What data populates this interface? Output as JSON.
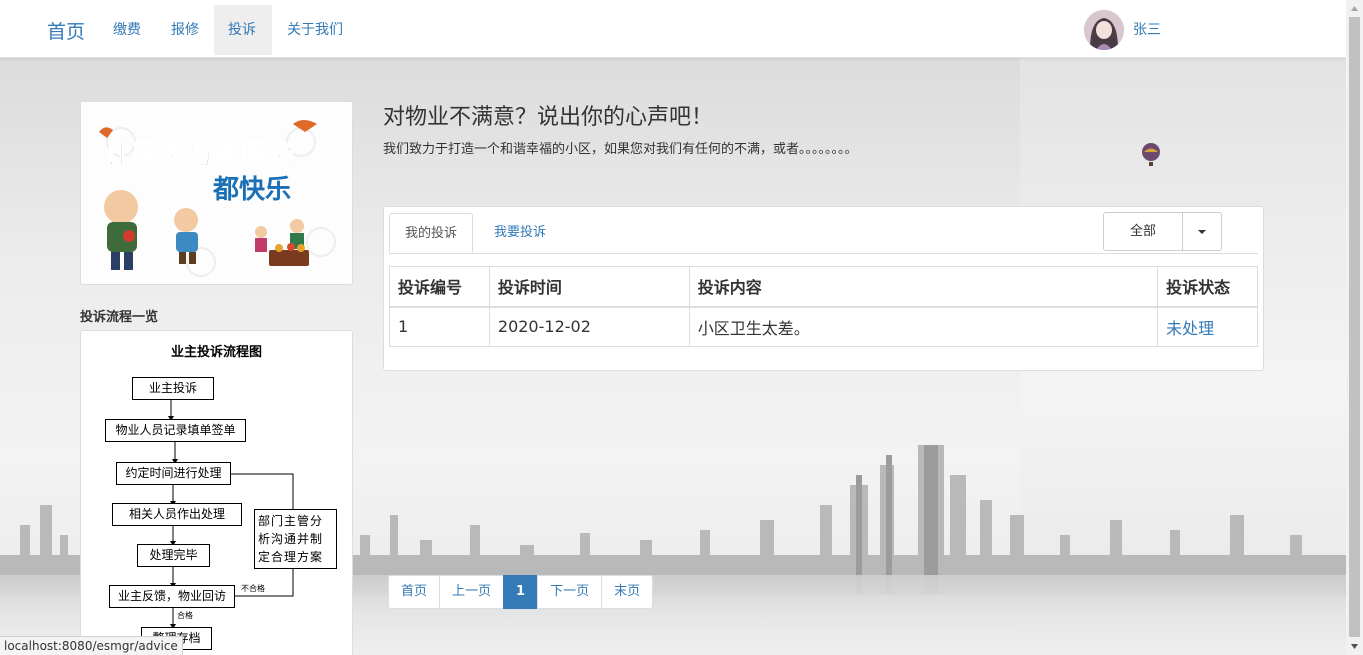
{
  "navbar": {
    "brand": "首页",
    "items": [
      "缴费",
      "报修",
      "投诉",
      "关于我们"
    ],
    "active_index": 2,
    "user_name": "张三"
  },
  "sidebar": {
    "banner_text_line1": "让服务与被服务",
    "banner_text_line2": "都快乐",
    "flow_title": "投诉流程一览",
    "flowchart": {
      "heading": "业主投诉流程图",
      "nodes": [
        "业主投诉",
        "物业人员记录填单签单",
        "约定时间进行处理",
        "相关人员作出处理",
        "处理完毕",
        "业主反馈，物业回访",
        "整理存档"
      ],
      "side_node": "部门主管分析沟通并制定合理方案",
      "label_fail": "不合格",
      "label_pass": "合格"
    }
  },
  "main": {
    "heading": "对物业不满意？说出你的心声吧！",
    "subheading": "我们致力于打造一个和谐幸福的小区，如果您对我们有任何的不满，或者。。。。。。。。",
    "tabs": [
      "我的投诉",
      "我要投诉"
    ],
    "active_tab": 0,
    "filter_label": "全部",
    "table": {
      "headers": [
        "投诉编号",
        "投诉时间",
        "投诉内容",
        "投诉状态"
      ],
      "rows": [
        {
          "id": "1",
          "time": "2020-12-02",
          "content": "小区卫生太差。",
          "status": "未处理"
        }
      ]
    },
    "pagination": [
      "首页",
      "上一页",
      "1",
      "下一页",
      "末页"
    ],
    "current_page": "1"
  },
  "statusbar": {
    "url": "localhost:8080/esmgr/advice"
  },
  "colors": {
    "link": "#337ab7",
    "active_page": "#337ab7",
    "banner_title": "#1a6fb5"
  }
}
